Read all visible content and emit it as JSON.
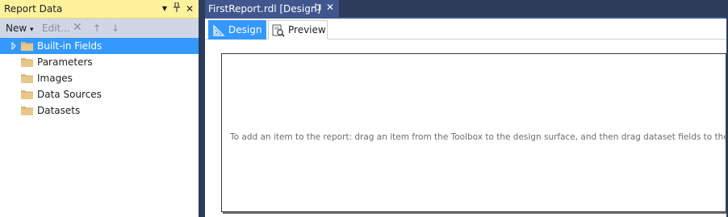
{
  "report_pane": {
    "title": "Report Data",
    "dropdown_glyph": "▼",
    "pin_glyph": "⊥",
    "close_glyph": "✕",
    "toolbar": {
      "new_label": "New",
      "new_arrow": "▾",
      "edit_label": "Edit...",
      "delete_glyph": "✕",
      "move_up_glyph": "↑",
      "move_down_glyph": "↓"
    },
    "tree": [
      {
        "label": "Built-in Fields",
        "selected": true,
        "expandable": true
      },
      {
        "label": "Parameters"
      },
      {
        "label": "Images"
      },
      {
        "label": "Data Sources"
      },
      {
        "label": "Datasets"
      }
    ]
  },
  "document": {
    "tab_title": "FirstReport.rdl [Design]",
    "pin_glyph": "⊣",
    "close_glyph": "✕",
    "view_tabs": [
      {
        "label": "Design",
        "active": true
      },
      {
        "label": "Preview",
        "active": false
      }
    ],
    "design_hint": "To add an item to the report: drag an item from the Toolbox to the design surface, and then drag dataset fields to the item."
  },
  "colors": {
    "title_bar": "#fff29d",
    "toolbar": "#cfd6e5",
    "selection": "#3399ff",
    "document_tab": "#40568d",
    "chrome": "#2d3c5b",
    "folder": "#dcb67a"
  }
}
